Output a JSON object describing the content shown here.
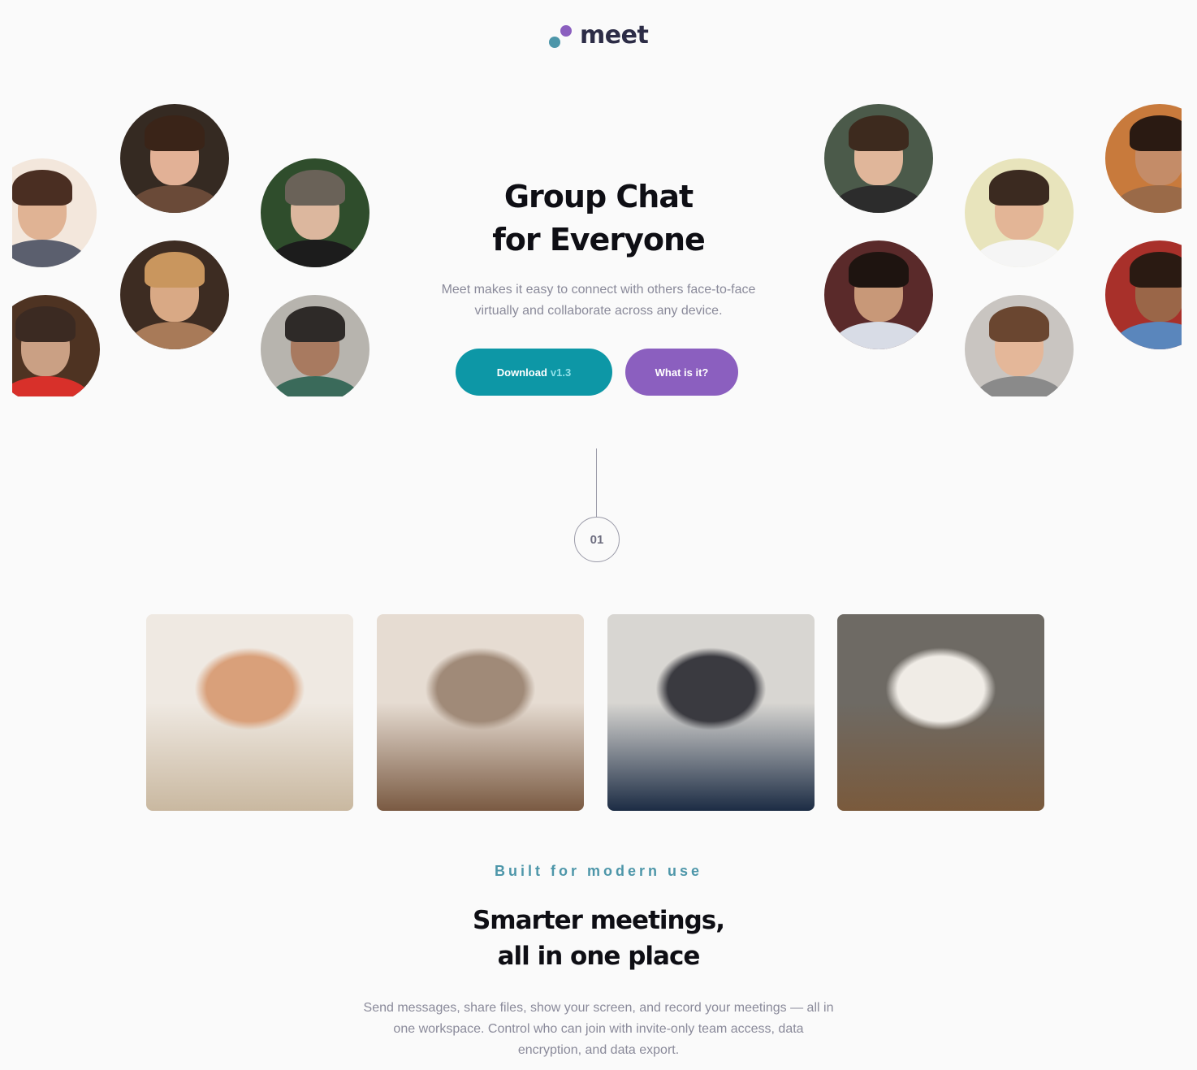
{
  "brand": {
    "name": "meet",
    "colors": {
      "teal": "#4d96a9",
      "purple": "#8b5fbf",
      "text": "#2c2c46"
    }
  },
  "hero": {
    "title_line1": "Group Chat",
    "title_line2": "for Everyone",
    "description": "Meet makes it easy to connect with others face-to-face virtually and collaborate across any device.",
    "download_label": "Download",
    "download_version": "v1.3",
    "what_label": "What is it?",
    "colors": {
      "download": "#0d97a6",
      "what": "#8b5fbf"
    }
  },
  "avatars_left": [
    {
      "name": "man-side",
      "skin": "#e0b394",
      "hair": "#4a2e22",
      "bg": "#f3e7dc",
      "shirt": "#5b5f6e"
    },
    {
      "name": "woman-smiling",
      "skin": "#e2b196",
      "hair": "#3a2418",
      "bg": "#352a22",
      "shirt": "#6a4a38"
    },
    {
      "name": "man-beard",
      "skin": "#caa084",
      "hair": "#3b2a22",
      "bg": "#4e3322",
      "shirt": "#d8302a"
    },
    {
      "name": "woman-sunlight",
      "skin": "#d9a985",
      "hair": "#c9965e",
      "bg": "#3d2c22",
      "shirt": "#a87a58"
    },
    {
      "name": "man-glasses",
      "skin": "#dcb79e",
      "hair": "#6a6258",
      "bg": "#2f4d2c",
      "shirt": "#1c1c1c"
    },
    {
      "name": "man-grey",
      "skin": "#a87a60",
      "hair": "#2e2a28",
      "bg": "#b7b4ae",
      "shirt": "#3a6a5a"
    }
  ],
  "avatars_right": [
    {
      "name": "man-sunglasses",
      "skin": "#e0b69a",
      "hair": "#3d2a1e",
      "bg": "#4b5a4a",
      "shirt": "#2c2c2c"
    },
    {
      "name": "man-laughing",
      "skin": "#e3b596",
      "hair": "#3b2a20",
      "bg": "#e8e4bc",
      "shirt": "#f5f5f5"
    },
    {
      "name": "man-flowers",
      "skin": "#c89878",
      "hair": "#1e1410",
      "bg": "#5a2a2a",
      "shirt": "#d8dce6"
    },
    {
      "name": "man-curly",
      "skin": "#e4b799",
      "hair": "#6a4630",
      "bg": "#c9c5c1",
      "shirt": "#8a8a8a"
    },
    {
      "name": "couple",
      "skin": "#c48c68",
      "hair": "#2a1a12",
      "bg": "#c87a3c",
      "shirt": "#9a6a48"
    },
    {
      "name": "woman-denim",
      "skin": "#9a6648",
      "hair": "#2a1a12",
      "bg": "#a8302a",
      "shirt": "#5a86bc"
    }
  ],
  "step": {
    "number": "01"
  },
  "photos": [
    {
      "name": "women-phone",
      "top": "#efe9e2",
      "bottom": "#c9b8a0",
      "accent": "#d9a07a"
    },
    {
      "name": "woman-laptop",
      "top": "#e6dcd2",
      "bottom": "#7a5a42",
      "accent": "#a08a78"
    },
    {
      "name": "man-videocall",
      "top": "#d8d6d2",
      "bottom": "#1c2c44",
      "accent": "#3a3a40"
    },
    {
      "name": "man-phone",
      "top": "#6e6a64",
      "bottom": "#7a5a3c",
      "accent": "#f0ece6"
    }
  ],
  "section": {
    "eyebrow": "Built for modern use",
    "title_line1": "Smarter meetings,",
    "title_line2": "all in one place",
    "description": "Send messages, share files, show your screen, and record your meetings — all in one workspace. Control who can join with invite-only team access, data encryption, and data export."
  }
}
